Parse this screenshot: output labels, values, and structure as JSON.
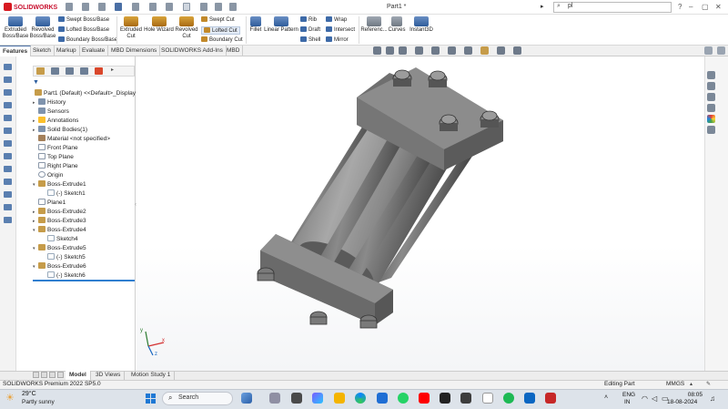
{
  "app": {
    "name": "SOLIDWORKS",
    "document_title": "Part1 *"
  },
  "search": {
    "value": "pl"
  },
  "command_manager": {
    "extruded_boss": "Extruded\nBoss/Base",
    "revolved_boss": "Revolved\nBoss/Base",
    "swept_boss": "Swept Boss/Base",
    "lofted_boss": "Lofted Boss/Base",
    "boundary_boss": "Boundary Boss/Base",
    "extruded_cut": "Extruded\nCut",
    "hole_wizard": "Hole Wizard",
    "revolved_cut": "Revolved\nCut",
    "swept_cut": "Swept Cut",
    "lofted_cut": "Lofted Cut",
    "boundary_cut": "Boundary Cut",
    "fillet": "Fillet",
    "linear_pattern": "Linear Pattern",
    "rib": "Rib",
    "draft": "Draft",
    "shell": "Shell",
    "wrap": "Wrap",
    "intersect": "Intersect",
    "mirror": "Mirror",
    "reference": "Referenc...",
    "curves": "Curves",
    "instant3d": "Instant3D"
  },
  "tabs": [
    "Features",
    "Sketch",
    "Markup",
    "Evaluate",
    "MBD Dimensions",
    "SOLIDWORKS Add-Ins",
    "MBD"
  ],
  "feature_tree": {
    "root": "Part1 (Default) <<Default>_Display S",
    "items": [
      {
        "label": "History",
        "icon": "history"
      },
      {
        "label": "Sensors",
        "icon": "sensor"
      },
      {
        "label": "Annotations",
        "icon": "annotation"
      },
      {
        "label": "Solid Bodies(1)",
        "icon": "solid-bodies"
      },
      {
        "label": "Material <not specified>",
        "icon": "material"
      },
      {
        "label": "Front Plane",
        "icon": "plane"
      },
      {
        "label": "Top Plane",
        "icon": "plane"
      },
      {
        "label": "Right Plane",
        "icon": "plane"
      },
      {
        "label": "Origin",
        "icon": "origin"
      },
      {
        "label": "Boss-Extrude1",
        "icon": "extrude"
      },
      {
        "label": "(-) Sketch1",
        "icon": "sketch"
      },
      {
        "label": "Plane1",
        "icon": "plane"
      },
      {
        "label": "Boss-Extrude2",
        "icon": "extrude"
      },
      {
        "label": "Boss-Extrude3",
        "icon": "extrude"
      },
      {
        "label": "Boss-Extrude4",
        "icon": "extrude"
      },
      {
        "label": "Sketch4",
        "icon": "sketch"
      },
      {
        "label": "Boss-Extrude5",
        "icon": "extrude"
      },
      {
        "label": "(-) Sketch5",
        "icon": "sketch"
      },
      {
        "label": "Boss-Extrude6",
        "icon": "extrude"
      },
      {
        "label": "(-) Sketch6",
        "icon": "sketch"
      }
    ]
  },
  "bottom_tabs": [
    "Model",
    "3D Views",
    "Motion Study 1"
  ],
  "status": {
    "product": "SOLIDWORKS Premium 2022 SP5.0",
    "mode": "Editing Part",
    "units": "MMGS"
  },
  "taskbar": {
    "weather_temp": "29°C",
    "weather_desc": "Partly sunny",
    "search_label": "Search",
    "lang_line1": "ENG",
    "lang_line2": "IN",
    "time": "08:05",
    "date": "18-08-2024"
  },
  "colors": {
    "accent": "#2f7fd0",
    "brand": "#d71920",
    "model_face": "#707070"
  }
}
